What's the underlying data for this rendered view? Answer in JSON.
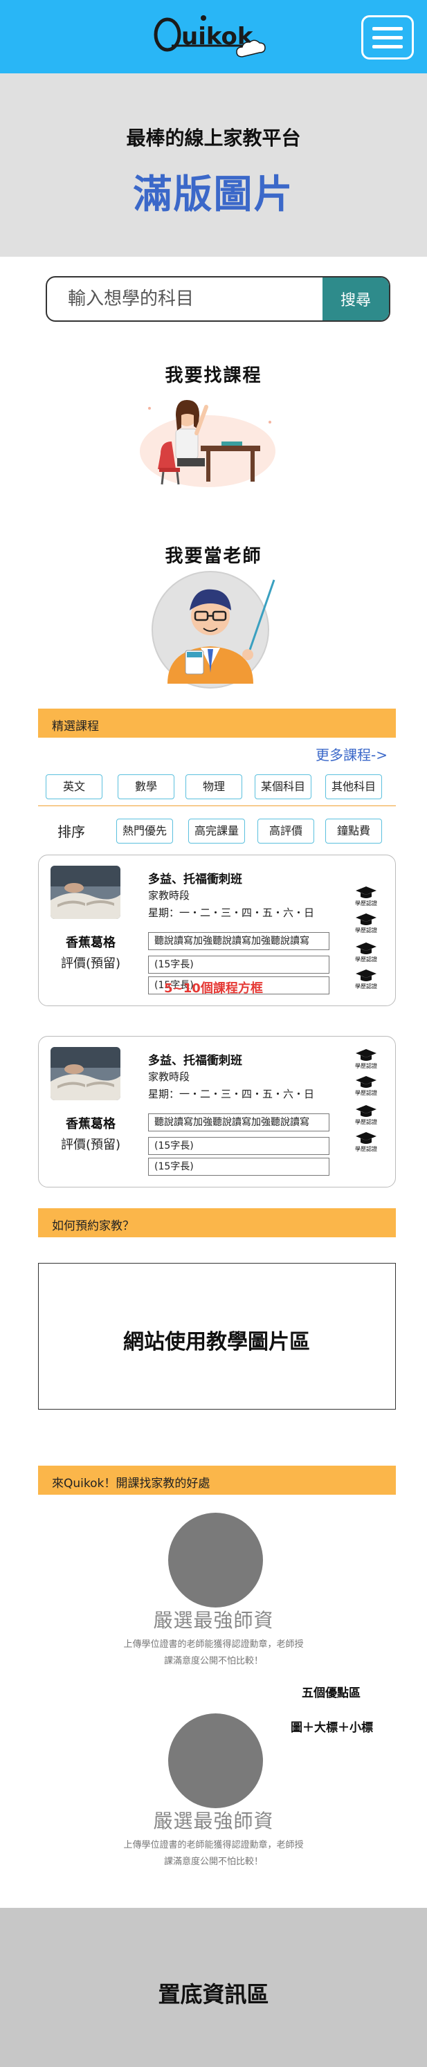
{
  "header": {
    "logo_text": "Quikok"
  },
  "hero": {
    "subtitle": "最棒的線上家教平台",
    "title": "滿版圖片"
  },
  "search": {
    "placeholder": "輸入想學的科目",
    "button_label": "搜尋"
  },
  "entries": {
    "find_course": "我要找課程",
    "become_teacher": "我要當老師"
  },
  "featured": {
    "section_title": "精選課程",
    "more_link": "更多課程->",
    "subjects": [
      "英文",
      "數學",
      "物理",
      "某個科目",
      "其他科目"
    ],
    "sort_label": "排序",
    "sort_options": [
      "熱門優先",
      "高完課量",
      "高評價",
      "鐘點費"
    ],
    "between_note": "5~10個課程方框",
    "cards": [
      {
        "teacher_name": "香蕉葛格",
        "rating": "評價(預留)",
        "course_title": "多益、托福衝刺班",
        "type": "家教時段",
        "days": "星期：一・二・三・四・五・六・日",
        "description": "聽說讀寫加強聽說讀寫加強聽說讀寫",
        "field_a": "(15字長)",
        "field_b": "(15字長)",
        "badges": [
          "學歷認證",
          "學歷認證",
          "學歷認證",
          "學歷認證"
        ]
      },
      {
        "teacher_name": "香蕉葛格",
        "rating": "評價(預留)",
        "course_title": "多益、托福衝刺班",
        "type": "家教時段",
        "days": "星期：一・二・三・四・五・六・日",
        "description": "聽說讀寫加強聽說讀寫加強聽說讀寫",
        "field_a": "(15字長)",
        "field_b": "(15字長)",
        "badges": [
          "學歷認證",
          "學歷認證",
          "學歷認證",
          "學歷認證"
        ]
      }
    ]
  },
  "booking": {
    "section_title": "如何預約家教？",
    "tutorial_placeholder": "網站使用教學圖片區"
  },
  "benefits": {
    "section_title": "來Quikok！開課找家教的好處",
    "items": [
      {
        "title": "嚴選最強師資",
        "desc_line1": "上傳學位證書的老師能獲得認證勳章，老師授",
        "desc_line2": "課滿意度公開不怕比較！"
      },
      {
        "title": "嚴選最強師資",
        "desc_line1": "上傳學位證書的老師能獲得認證勳章，老師授",
        "desc_line2": "課滿意度公開不怕比較！"
      }
    ],
    "note_line1": "五個優點區",
    "note_line2": "圖＋大標＋小標"
  },
  "footer": {
    "label": "置底資訊區"
  },
  "colors": {
    "header_bg": "#29b6f6",
    "hero_title": "#3b68c9",
    "search_button": "#2e8b8b",
    "section_bar": "#fbb64a",
    "chip_border": "#5bc0de",
    "between_note": "#e53935",
    "footer_bg": "#c7c7c7"
  }
}
